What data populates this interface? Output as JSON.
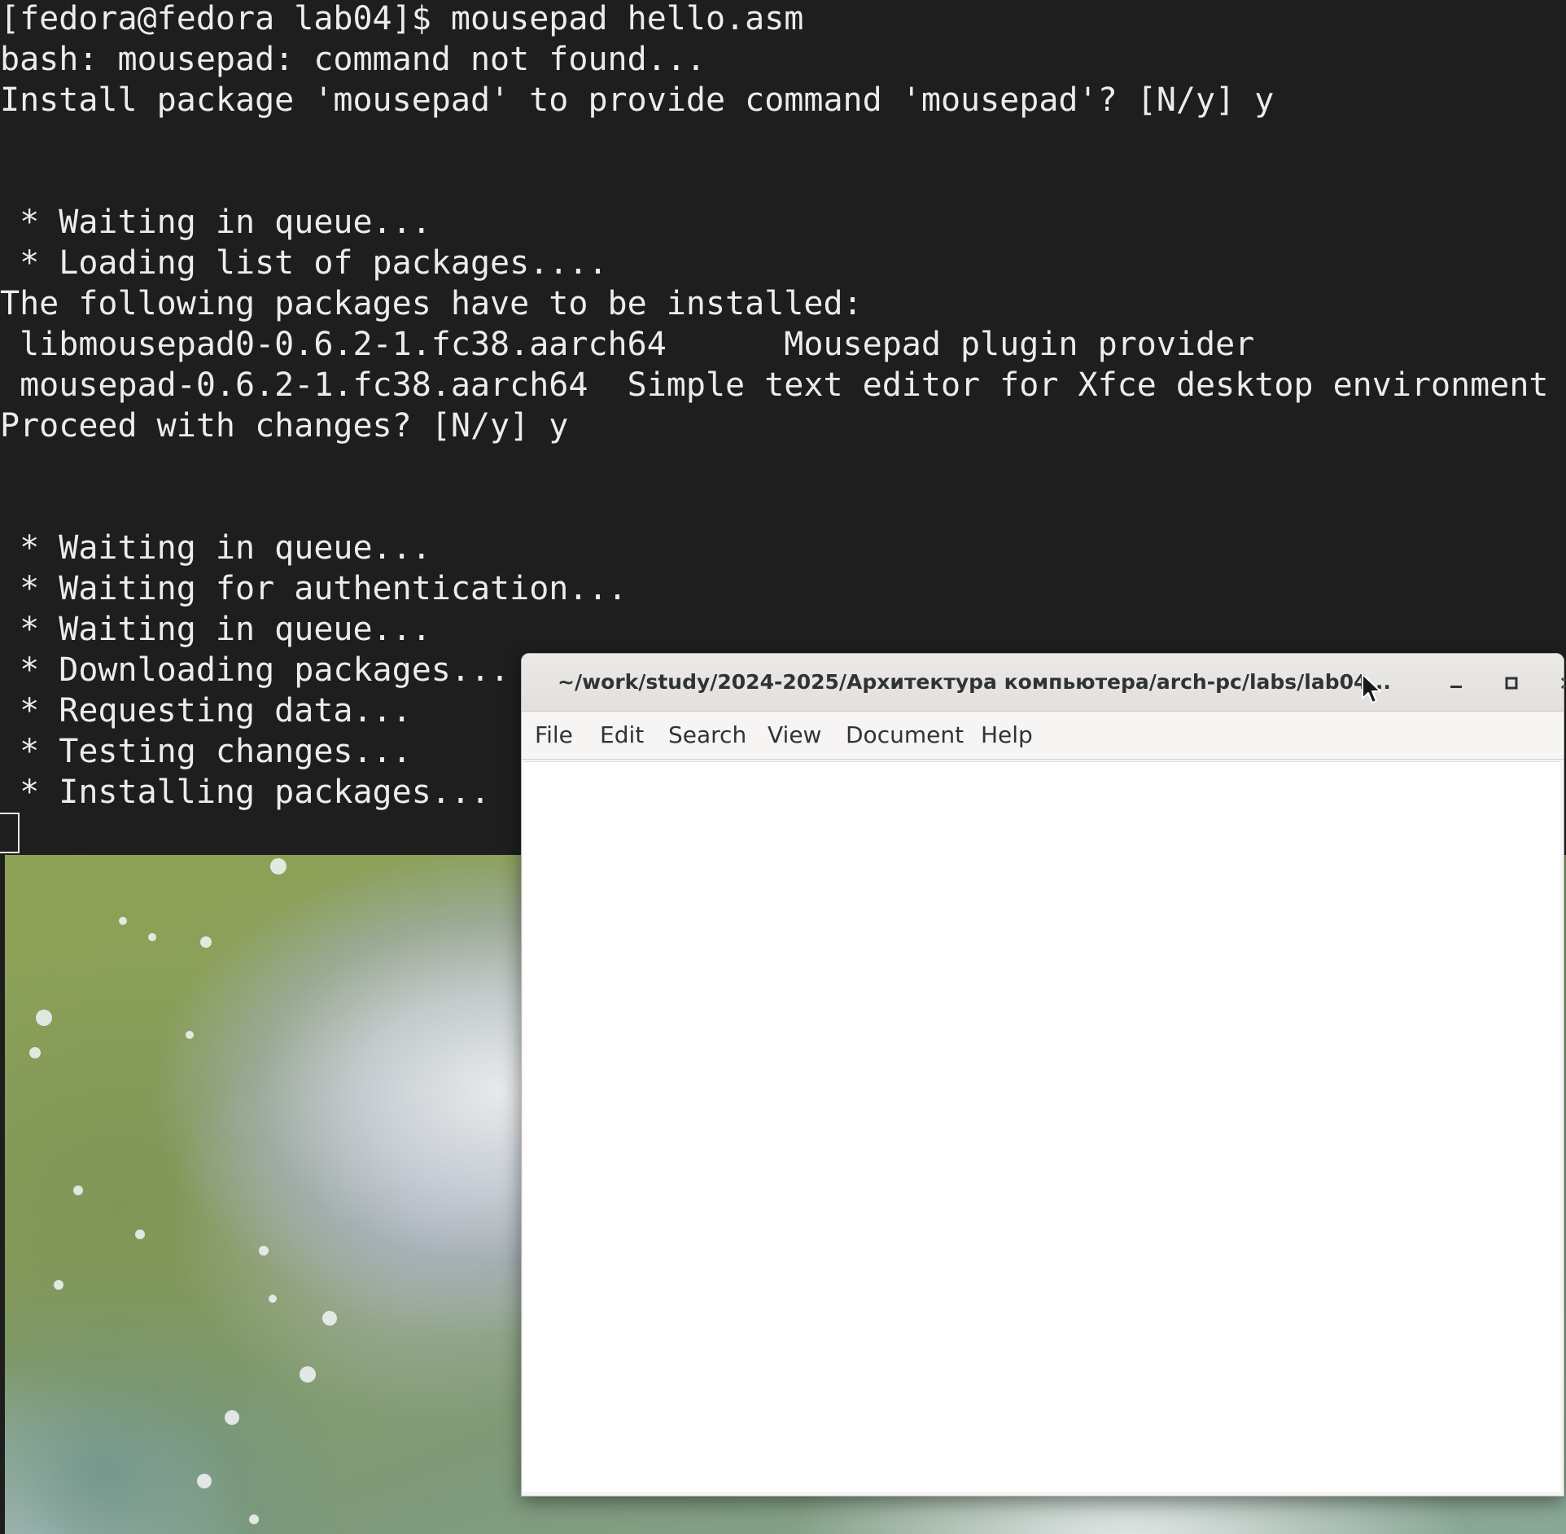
{
  "terminal": {
    "lines": [
      "[fedora@fedora lab04]$ mousepad hello.asm",
      "bash: mousepad: command not found...",
      "Install package 'mousepad' to provide command 'mousepad'? [N/y] y",
      "",
      "",
      " * Waiting in queue...",
      " * Loading list of packages....",
      "The following packages have to be installed:",
      " libmousepad0-0.6.2-1.fc38.aarch64      Mousepad plugin provider",
      " mousepad-0.6.2-1.fc38.aarch64  Simple text editor for Xfce desktop environment",
      "Proceed with changes? [N/y] y",
      "",
      "",
      " * Waiting in queue...",
      " * Waiting for authentication...",
      " * Waiting in queue...",
      " * Downloading packages...",
      " * Requesting data...",
      " * Testing changes...",
      " * Installing packages..."
    ]
  },
  "editor": {
    "title": "~/work/study/2024-2025/Архитектура компьютера/arch-pc/labs/lab04...",
    "menu": {
      "file": "File",
      "edit": "Edit",
      "search": "Search",
      "view": "View",
      "document": "Document",
      "help": "Help"
    },
    "content": ""
  },
  "icons": {
    "minimize": "minimize-icon",
    "maximize": "maximize-icon",
    "close": "close-icon",
    "pointer": "mouse-pointer-icon"
  },
  "colors": {
    "terminal_bg": "#1e1e1e",
    "terminal_fg": "#ececec",
    "window_chrome": "#e6e3e0",
    "editor_bg": "#ffffff"
  }
}
